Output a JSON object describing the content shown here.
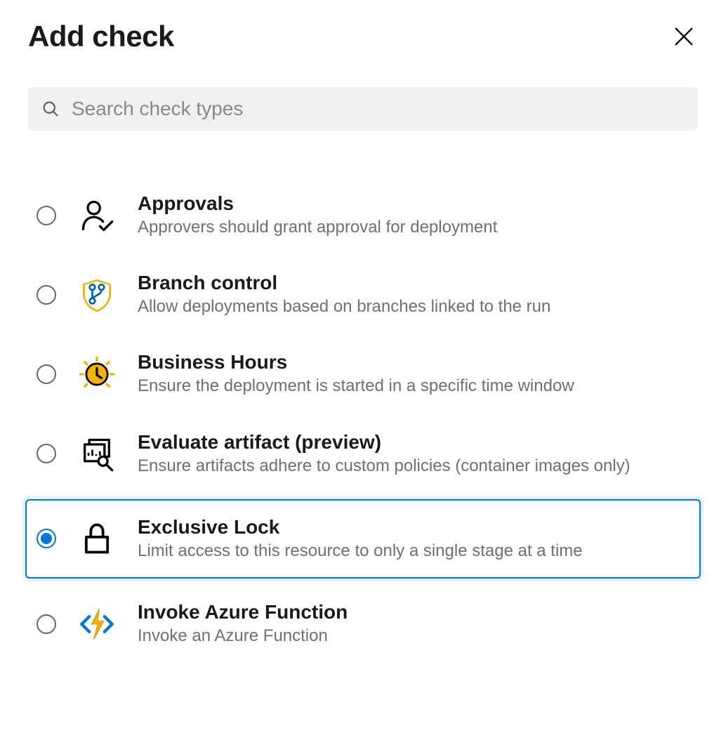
{
  "header": {
    "title": "Add check"
  },
  "search": {
    "placeholder": "Search check types",
    "value": ""
  },
  "selected_index": 4,
  "items": [
    {
      "id": "approvals",
      "label": "Approvals",
      "desc": "Approvers should grant approval for deployment",
      "icon": "person-check-icon"
    },
    {
      "id": "branch-control",
      "label": "Branch control",
      "desc": "Allow deployments based on branches linked to the run",
      "icon": "branch-shield-icon"
    },
    {
      "id": "business-hours",
      "label": "Business Hours",
      "desc": "Ensure the deployment is started in a specific time window",
      "icon": "clock-sun-icon"
    },
    {
      "id": "evaluate-artifact",
      "label": "Evaluate artifact (preview)",
      "desc": "Ensure artifacts adhere to custom policies (container images only)",
      "icon": "artifact-inspect-icon"
    },
    {
      "id": "exclusive-lock",
      "label": "Exclusive Lock",
      "desc": "Limit access to this resource to only a single stage at a time",
      "icon": "lock-icon"
    },
    {
      "id": "invoke-azure-function",
      "label": "Invoke Azure Function",
      "desc": "Invoke an Azure Function",
      "icon": "azure-function-icon"
    }
  ]
}
